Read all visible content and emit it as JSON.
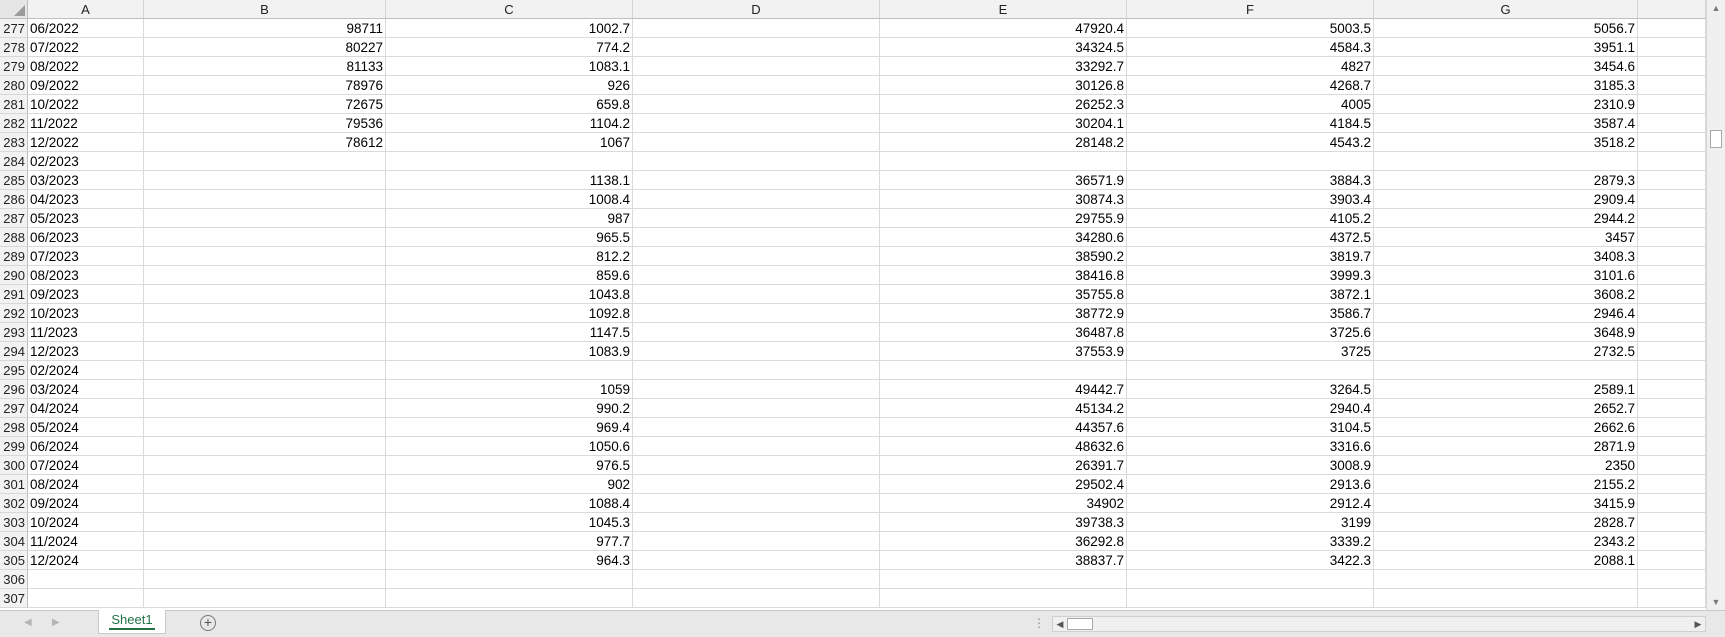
{
  "columns": [
    "A",
    "B",
    "C",
    "D",
    "E",
    "F",
    "G"
  ],
  "rows": [
    {
      "n": "277",
      "a": "06/2022",
      "b": "98711",
      "c": "1002.7",
      "d": "",
      "e": "47920.4",
      "f": "5003.5",
      "g": "5056.7"
    },
    {
      "n": "278",
      "a": "07/2022",
      "b": "80227",
      "c": "774.2",
      "d": "",
      "e": "34324.5",
      "f": "4584.3",
      "g": "3951.1"
    },
    {
      "n": "279",
      "a": "08/2022",
      "b": "81133",
      "c": "1083.1",
      "d": "",
      "e": "33292.7",
      "f": "4827",
      "g": "3454.6"
    },
    {
      "n": "280",
      "a": "09/2022",
      "b": "78976",
      "c": "926",
      "d": "",
      "e": "30126.8",
      "f": "4268.7",
      "g": "3185.3"
    },
    {
      "n": "281",
      "a": "10/2022",
      "b": "72675",
      "c": "659.8",
      "d": "",
      "e": "26252.3",
      "f": "4005",
      "g": "2310.9"
    },
    {
      "n": "282",
      "a": "11/2022",
      "b": "79536",
      "c": "1104.2",
      "d": "",
      "e": "30204.1",
      "f": "4184.5",
      "g": "3587.4"
    },
    {
      "n": "283",
      "a": "12/2022",
      "b": "78612",
      "c": "1067",
      "d": "",
      "e": "28148.2",
      "f": "4543.2",
      "g": "3518.2"
    },
    {
      "n": "284",
      "a": "02/2023",
      "b": "",
      "c": "",
      "d": "",
      "e": "",
      "f": "",
      "g": ""
    },
    {
      "n": "285",
      "a": "03/2023",
      "b": "",
      "c": "1138.1",
      "d": "",
      "e": "36571.9",
      "f": "3884.3",
      "g": "2879.3"
    },
    {
      "n": "286",
      "a": "04/2023",
      "b": "",
      "c": "1008.4",
      "d": "",
      "e": "30874.3",
      "f": "3903.4",
      "g": "2909.4"
    },
    {
      "n": "287",
      "a": "05/2023",
      "b": "",
      "c": "987",
      "d": "",
      "e": "29755.9",
      "f": "4105.2",
      "g": "2944.2"
    },
    {
      "n": "288",
      "a": "06/2023",
      "b": "",
      "c": "965.5",
      "d": "",
      "e": "34280.6",
      "f": "4372.5",
      "g": "3457"
    },
    {
      "n": "289",
      "a": "07/2023",
      "b": "",
      "c": "812.2",
      "d": "",
      "e": "38590.2",
      "f": "3819.7",
      "g": "3408.3"
    },
    {
      "n": "290",
      "a": "08/2023",
      "b": "",
      "c": "859.6",
      "d": "",
      "e": "38416.8",
      "f": "3999.3",
      "g": "3101.6"
    },
    {
      "n": "291",
      "a": "09/2023",
      "b": "",
      "c": "1043.8",
      "d": "",
      "e": "35755.8",
      "f": "3872.1",
      "g": "3608.2"
    },
    {
      "n": "292",
      "a": "10/2023",
      "b": "",
      "c": "1092.8",
      "d": "",
      "e": "38772.9",
      "f": "3586.7",
      "g": "2946.4"
    },
    {
      "n": "293",
      "a": "11/2023",
      "b": "",
      "c": "1147.5",
      "d": "",
      "e": "36487.8",
      "f": "3725.6",
      "g": "3648.9"
    },
    {
      "n": "294",
      "a": "12/2023",
      "b": "",
      "c": "1083.9",
      "d": "",
      "e": "37553.9",
      "f": "3725",
      "g": "2732.5"
    },
    {
      "n": "295",
      "a": "02/2024",
      "b": "",
      "c": "",
      "d": "",
      "e": "",
      "f": "",
      "g": ""
    },
    {
      "n": "296",
      "a": "03/2024",
      "b": "",
      "c": "1059",
      "d": "",
      "e": "49442.7",
      "f": "3264.5",
      "g": "2589.1"
    },
    {
      "n": "297",
      "a": "04/2024",
      "b": "",
      "c": "990.2",
      "d": "",
      "e": "45134.2",
      "f": "2940.4",
      "g": "2652.7"
    },
    {
      "n": "298",
      "a": "05/2024",
      "b": "",
      "c": "969.4",
      "d": "",
      "e": "44357.6",
      "f": "3104.5",
      "g": "2662.6"
    },
    {
      "n": "299",
      "a": "06/2024",
      "b": "",
      "c": "1050.6",
      "d": "",
      "e": "48632.6",
      "f": "3316.6",
      "g": "2871.9"
    },
    {
      "n": "300",
      "a": "07/2024",
      "b": "",
      "c": "976.5",
      "d": "",
      "e": "26391.7",
      "f": "3008.9",
      "g": "2350"
    },
    {
      "n": "301",
      "a": "08/2024",
      "b": "",
      "c": "902",
      "d": "",
      "e": "29502.4",
      "f": "2913.6",
      "g": "2155.2"
    },
    {
      "n": "302",
      "a": "09/2024",
      "b": "",
      "c": "1088.4",
      "d": "",
      "e": "34902",
      "f": "2912.4",
      "g": "3415.9"
    },
    {
      "n": "303",
      "a": "10/2024",
      "b": "",
      "c": "1045.3",
      "d": "",
      "e": "39738.3",
      "f": "3199",
      "g": "2828.7"
    },
    {
      "n": "304",
      "a": "11/2024",
      "b": "",
      "c": "977.7",
      "d": "",
      "e": "36292.8",
      "f": "3339.2",
      "g": "2343.2"
    },
    {
      "n": "305",
      "a": "12/2024",
      "b": "",
      "c": "964.3",
      "d": "",
      "e": "38837.7",
      "f": "3422.3",
      "g": "2088.1"
    },
    {
      "n": "306",
      "a": "",
      "b": "",
      "c": "",
      "d": "",
      "e": "",
      "f": "",
      "g": ""
    },
    {
      "n": "307",
      "a": "",
      "b": "",
      "c": "",
      "d": "",
      "e": "",
      "f": "",
      "g": ""
    }
  ],
  "sheet_tab": {
    "label": "Sheet1",
    "color": "#217346"
  },
  "icons": {
    "add_sheet": "plus-circle-icon",
    "select_all": "select-all-triangle-icon"
  }
}
